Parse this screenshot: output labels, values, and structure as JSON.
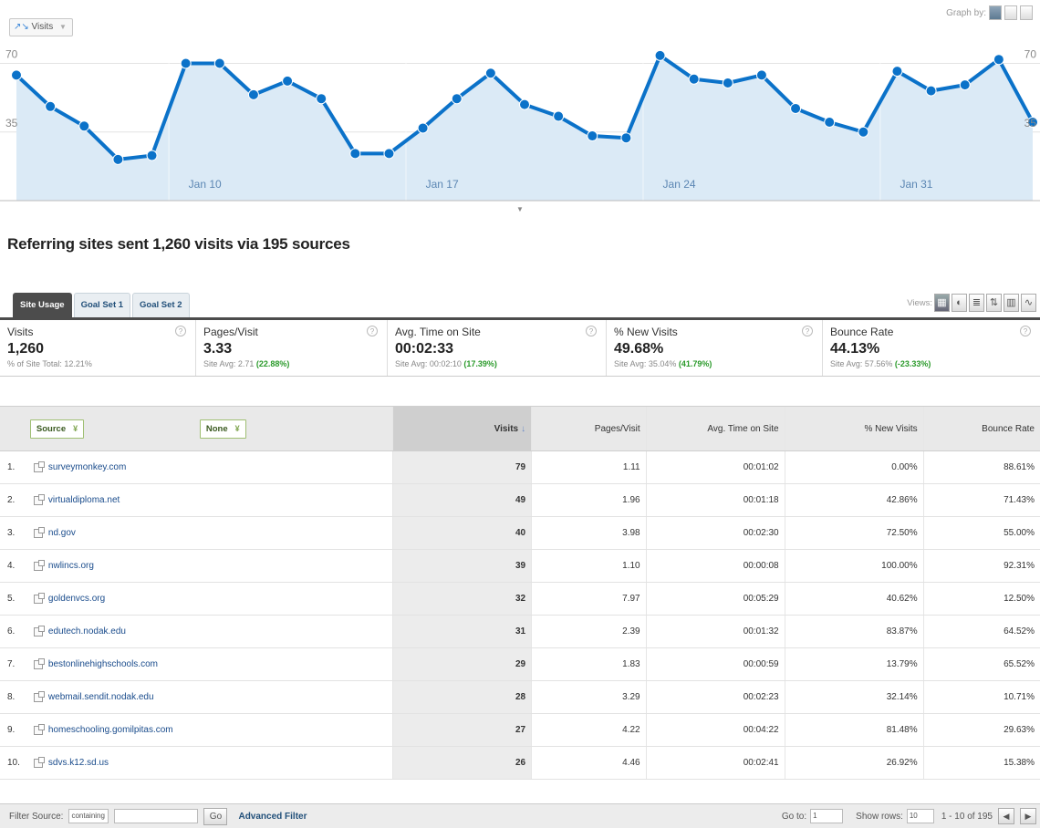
{
  "chart_data": {
    "type": "area",
    "series": [
      {
        "values": [
          64,
          48,
          38,
          21,
          23,
          70,
          70,
          54,
          61,
          52,
          24,
          24,
          37,
          52,
          65,
          49,
          43,
          33,
          32,
          74,
          62,
          60,
          64,
          47,
          40,
          35,
          66,
          56,
          59,
          72,
          40
        ]
      }
    ],
    "y_tick_labels": [
      "70",
      "35"
    ],
    "right_tick_labels": [
      "70",
      "35"
    ],
    "x_tick_labels": [
      "Jan 10",
      "Jan 17",
      "Jan 24",
      "Jan 31"
    ],
    "x_tick_indices": [
      5,
      12,
      19,
      26
    ],
    "ylim": [
      0,
      80
    ],
    "color": "#0b72c9",
    "fill": "#dbeaf6"
  },
  "topbar": {
    "metric_label": "Visits",
    "graph_by_label": "Graph by:"
  },
  "headline": "Referring sites sent 1,260 visits via 195 sources",
  "tabs": [
    "Site Usage",
    "Goal Set 1",
    "Goal Set 2"
  ],
  "views_label": "Views:",
  "scorecards": [
    {
      "label": "Visits",
      "value": "1,260",
      "sub": "% of Site Total: 12.21%",
      "pct": ""
    },
    {
      "label": "Pages/Visit",
      "value": "3.33",
      "sub": "Site Avg: 2.71 ",
      "pct": "(22.88%)"
    },
    {
      "label": "Avg. Time on Site",
      "value": "00:02:33",
      "sub": "Site Avg: 00:02:10 ",
      "pct": "(17.39%)"
    },
    {
      "label": "% New Visits",
      "value": "49.68%",
      "sub": "Site Avg: 35.04% ",
      "pct": "(41.79%)"
    },
    {
      "label": "Bounce Rate",
      "value": "44.13%",
      "sub": "Site Avg: 57.56% ",
      "pct": "(-23.33%)"
    }
  ],
  "table": {
    "dimension_primary": "Source",
    "dimension_secondary": "None",
    "columns": [
      "Visits",
      "Pages/Visit",
      "Avg. Time on Site",
      "% New Visits",
      "Bounce Rate"
    ],
    "rows": [
      {
        "n": "1.",
        "source": "surveymonkey.com",
        "visits": "79",
        "ppv": "1.11",
        "time": "00:01:02",
        "new": "0.00%",
        "bounce": "88.61%"
      },
      {
        "n": "2.",
        "source": "virtualdiploma.net",
        "visits": "49",
        "ppv": "1.96",
        "time": "00:01:18",
        "new": "42.86%",
        "bounce": "71.43%"
      },
      {
        "n": "3.",
        "source": "nd.gov",
        "visits": "40",
        "ppv": "3.98",
        "time": "00:02:30",
        "new": "72.50%",
        "bounce": "55.00%"
      },
      {
        "n": "4.",
        "source": "nwlincs.org",
        "visits": "39",
        "ppv": "1.10",
        "time": "00:00:08",
        "new": "100.00%",
        "bounce": "92.31%"
      },
      {
        "n": "5.",
        "source": "goldenvcs.org",
        "visits": "32",
        "ppv": "7.97",
        "time": "00:05:29",
        "new": "40.62%",
        "bounce": "12.50%"
      },
      {
        "n": "6.",
        "source": "edutech.nodak.edu",
        "visits": "31",
        "ppv": "2.39",
        "time": "00:01:32",
        "new": "83.87%",
        "bounce": "64.52%"
      },
      {
        "n": "7.",
        "source": "bestonlinehighschools.com",
        "visits": "29",
        "ppv": "1.83",
        "time": "00:00:59",
        "new": "13.79%",
        "bounce": "65.52%"
      },
      {
        "n": "8.",
        "source": "webmail.sendit.nodak.edu",
        "visits": "28",
        "ppv": "3.29",
        "time": "00:02:23",
        "new": "32.14%",
        "bounce": "10.71%"
      },
      {
        "n": "9.",
        "source": "homeschooling.gomilpitas.com",
        "visits": "27",
        "ppv": "4.22",
        "time": "00:04:22",
        "new": "81.48%",
        "bounce": "29.63%"
      },
      {
        "n": "10.",
        "source": "sdvs.k12.sd.us",
        "visits": "26",
        "ppv": "4.46",
        "time": "00:02:41",
        "new": "26.92%",
        "bounce": "15.38%"
      }
    ]
  },
  "footer": {
    "filter_label": "Filter Source:",
    "filter_mode": "containing",
    "go_label": "Go",
    "advanced_label": "Advanced Filter",
    "goto_label": "Go to:",
    "goto_value": "1",
    "show_rows_label": "Show rows:",
    "show_rows_value": "10",
    "range_label": "1 - 10 of 195",
    "prev_icon": "◀",
    "next_icon": "▶"
  }
}
